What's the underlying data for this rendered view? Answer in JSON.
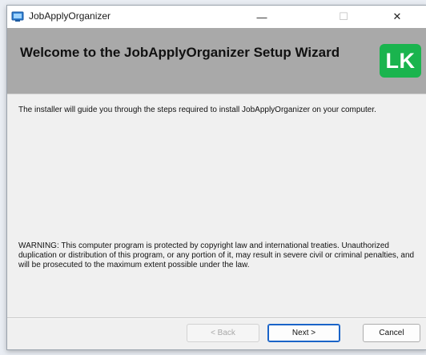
{
  "window": {
    "title": "JobApplyOrganizer",
    "minimize_glyph": "—",
    "maximize_glyph": "☐",
    "close_glyph": "✕"
  },
  "header": {
    "title": "Welcome to the JobApplyOrganizer Setup Wizard",
    "logo_text": "LK",
    "logo_color": "#1ab44e"
  },
  "body": {
    "intro": "The installer will guide you through the steps required to install JobApplyOrganizer on your computer.",
    "warning": "WARNING: This computer program is protected by copyright law and international treaties. Unauthorized duplication or distribution of this program, or any portion of it, may result in severe civil or criminal penalties, and will be prosecuted to the maximum extent possible under the law."
  },
  "buttons": {
    "back": "< Back",
    "next": "Next >",
    "cancel": "Cancel"
  }
}
